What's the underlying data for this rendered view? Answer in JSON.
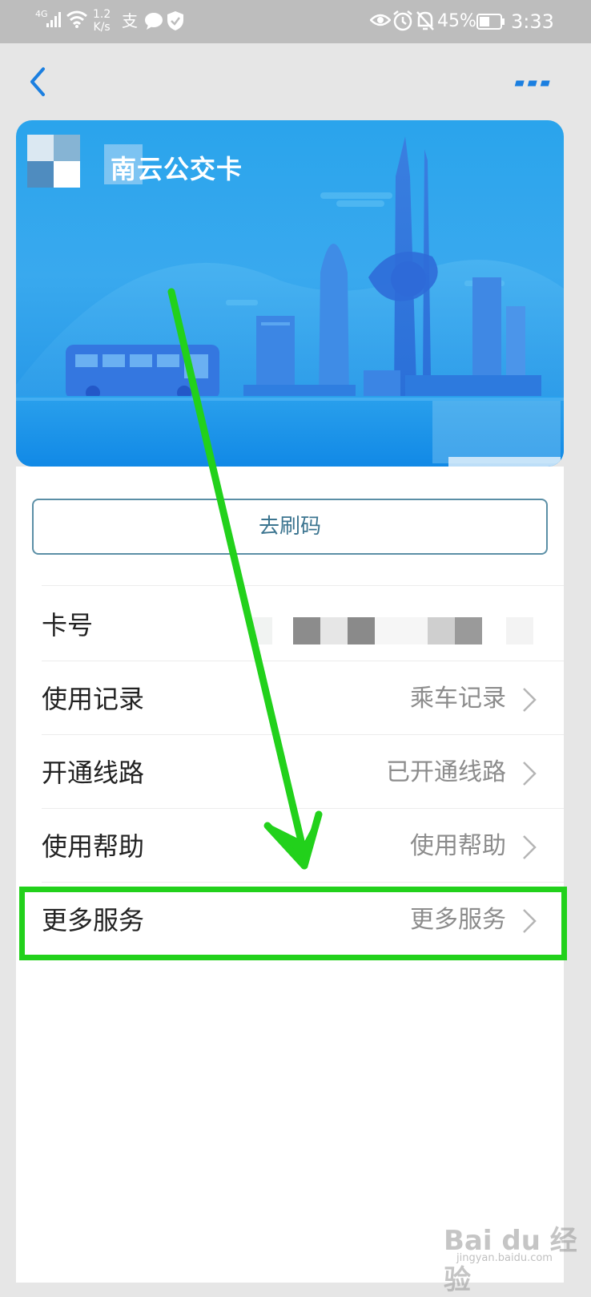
{
  "status_bar": {
    "network_type": "4G",
    "speed_value": "1.2",
    "speed_unit": "K/s",
    "alipay_glyph": "支",
    "battery_percent": "45%",
    "time": "3:33",
    "icons": [
      "signal-icon",
      "wifi-icon",
      "alipay-icon",
      "chat-icon",
      "shield-icon",
      "eye-icon",
      "alarm-icon",
      "bell-off-icon",
      "battery-icon"
    ]
  },
  "nav": {
    "back_icon": "chevron-left-icon",
    "more_icon": "more-dots-icon",
    "accent_color": "#1b7fe0"
  },
  "card": {
    "title": "南云公交卡",
    "colors": {
      "top": "#2aa4ec",
      "bottom": "#1d8fe4"
    }
  },
  "actions": {
    "qr_button_label": "去刷码"
  },
  "rows": [
    {
      "label": "卡号",
      "value": "",
      "masked": true
    },
    {
      "label": "使用记录",
      "value": "乘车记录"
    },
    {
      "label": "开通线路",
      "value": "已开通线路"
    },
    {
      "label": "使用帮助",
      "value": "使用帮助"
    },
    {
      "label": "更多服务",
      "value": "更多服务",
      "highlighted": true
    }
  ],
  "annotation": {
    "highlight_color": "#22d11b"
  },
  "watermark": {
    "brand": "Bai du 经验",
    "url": "jingyan.baidu.com"
  }
}
